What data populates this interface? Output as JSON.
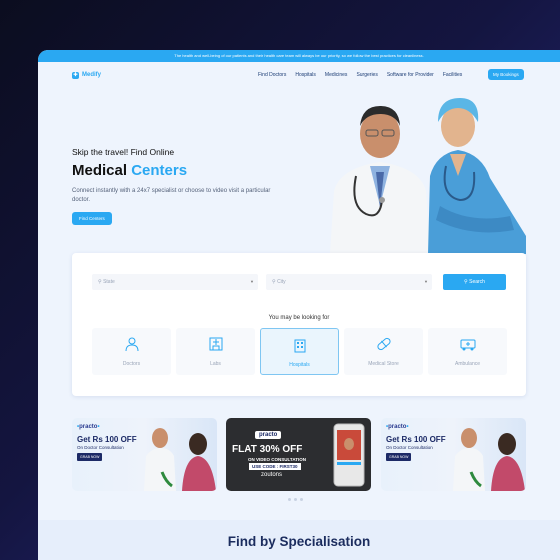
{
  "announcement": "The health and well-being of our patients and their health care team will always be our priority, so we follow the best practices for cleanliness.",
  "brand": {
    "name": "Medify"
  },
  "nav": {
    "items": [
      "Find Doctors",
      "Hospitals",
      "Medicines",
      "Surgeries",
      "Software for Provider",
      "Facilities"
    ],
    "bookings_label": "My Bookings"
  },
  "hero": {
    "subtitle": "Skip the travel! Find Online",
    "title_plain": "Medical ",
    "title_accent": "Centers",
    "description": "Connect instantly with a 24x7 specialist or choose to video visit a particular doctor.",
    "cta_label": "Find Centers"
  },
  "search": {
    "state_placeholder": "State",
    "city_placeholder": "City",
    "button_label": "Search"
  },
  "looking_for": {
    "heading": "You may be looking for",
    "categories": [
      {
        "label": "Doctors",
        "icon": "doctor-icon"
      },
      {
        "label": "Labs",
        "icon": "lab-icon"
      },
      {
        "label": "Hospitals",
        "icon": "hospital-icon",
        "active": true
      },
      {
        "label": "Medical Store",
        "icon": "capsule-icon"
      },
      {
        "label": "Ambulance",
        "icon": "ambulance-icon"
      }
    ]
  },
  "offers": [
    {
      "brand": "practo",
      "headline": "Get Rs 100 OFF",
      "subline": "On Doctor Consultation",
      "button": "GRAB NOW"
    },
    {
      "brand": "practo",
      "headline": "FLAT 30% OFF",
      "subline": "ON VIDEO CONSULTATION",
      "code": "USE CODE : FIRST30",
      "partner": "zoutons"
    },
    {
      "brand": "practo",
      "headline": "Get Rs 100 OFF",
      "subline": "On Doctor Consultation",
      "button": "GRAB NOW"
    }
  ],
  "carousel": {
    "slide_count": 4,
    "active_index": 0
  },
  "sections": {
    "specialisation_title": "Find by Specialisation"
  },
  "colors": {
    "accent": "#2aa8f2",
    "navy": "#1b2c5e"
  }
}
